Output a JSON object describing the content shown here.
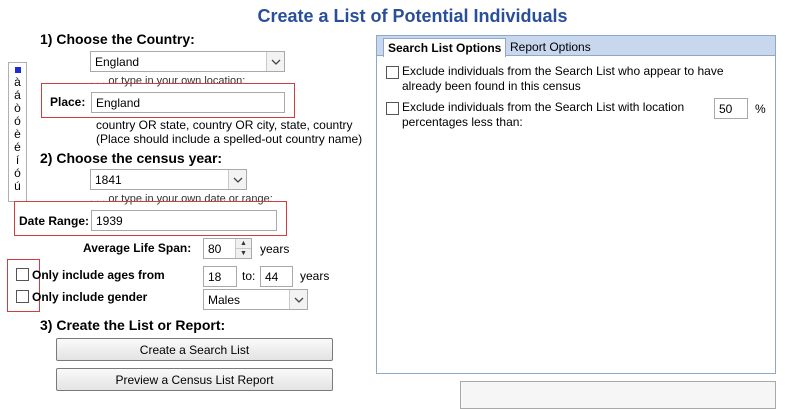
{
  "title": "Create a List of Potential Individuals",
  "step1": {
    "heading": "1) Choose the Country:",
    "country_value": "England",
    "hint": ". . . or type in your own location:",
    "place_label": "Place:",
    "place_value": "England",
    "format_line1": "country OR state, country OR city, state, country",
    "format_line2": "(Place should include a spelled-out country name)"
  },
  "special_chars": [
    "à",
    "á",
    "ò",
    "ó",
    "è",
    "é",
    "í",
    "ó",
    "ú"
  ],
  "step2": {
    "heading": "2) Choose the census year:",
    "year_value": "1841",
    "hint": ". . . or type in your own date or range:",
    "date_label": "Date Range:",
    "date_value": "1939",
    "life_span_label": "Average Life Span:",
    "life_span_value": "80",
    "life_span_unit": "years",
    "ages_label": "Only include ages from",
    "ages_from": "18",
    "ages_to_label": "to:",
    "ages_to": "44",
    "ages_unit": "years",
    "gender_label": "Only include gender",
    "gender_value": "Males"
  },
  "step3": {
    "heading": "3) Create the List or Report:",
    "search_button": "Create a Search List",
    "report_button": "Preview a Census List Report"
  },
  "options_panel": {
    "tabs": [
      "Search List Options",
      "Report Options"
    ],
    "option1_text": "Exclude individuals from the Search List who appear to have already been found in this census",
    "option2_text": "Exclude individuals from the Search List with location percentages less than:",
    "percent_value": "50",
    "percent_unit": "%"
  },
  "colors": {
    "title": "#2a4f9a",
    "highlight_box": "#d23c3c",
    "tab_strip": "#c6d7ee"
  }
}
